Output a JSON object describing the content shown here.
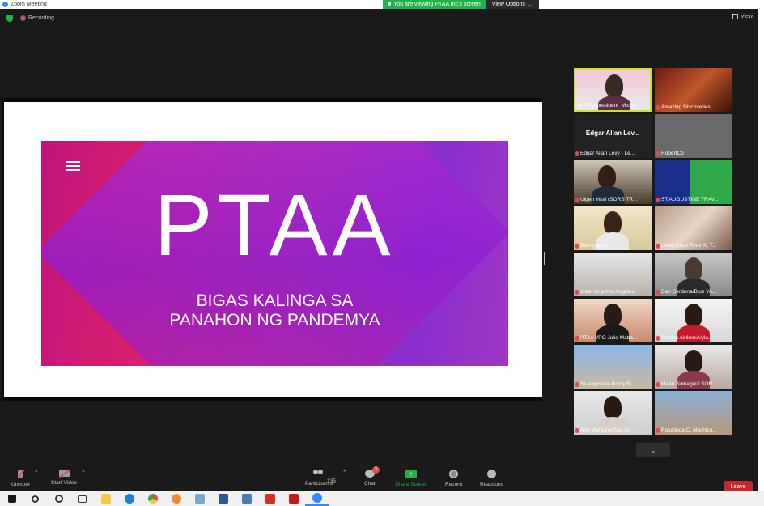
{
  "window": {
    "title": "Zoom Meeting"
  },
  "banner": {
    "message": "You are viewing PTAA Inc's screen",
    "options_label": "View Options"
  },
  "topbar": {
    "recording_label": "Recording",
    "view_label": "View"
  },
  "slide": {
    "title": "PTAA",
    "subtitle_line1": "BIGAS KALINGA SA",
    "subtitle_line2": "PANAHON NG PANDEMYA",
    "colors": {
      "primary": "#c0147c",
      "secondary": "#8a2ed0"
    }
  },
  "gallery": {
    "participants": [
      {
        "name": "PTAApresident_Miche...",
        "active": true
      },
      {
        "name": "Amazing Discoveries ..."
      },
      {
        "name": "Edgar Allan Levy - Le...",
        "display_name": "Edgar Allan Lev..."
      },
      {
        "name": "RobertCo"
      },
      {
        "name": "Ulgen Yesil (SORS TR..."
      },
      {
        "name": "ST.AUGUSTINE TRAV..."
      },
      {
        "name": "Bid Agapito"
      },
      {
        "name": "Lanie Cruz/ Riser K. T..."
      },
      {
        "name": "Juliet Angeline Angeles"
      },
      {
        "name": "Dan Cerdena/Blue Vo..."
      },
      {
        "name": "PTAA VPO Julie Maba..."
      },
      {
        "name": "Turkish Airlines/Vyla..."
      },
      {
        "name": "St.Augustine Romy R..."
      },
      {
        "name": "Maan Sumagui / SOR..."
      },
      {
        "name": "Ann Margaret San An..."
      },
      {
        "name": "Rosalinda C. Machico..."
      }
    ]
  },
  "toolbar": {
    "unmute": "Unmute",
    "start_video": "Start Video",
    "participants": "Participants",
    "participants_count": "135",
    "chat": "Chat",
    "chat_badge": "3",
    "share_screen": "Share Screen",
    "record": "Record",
    "reactions": "Reactions",
    "leave": "Leave"
  }
}
